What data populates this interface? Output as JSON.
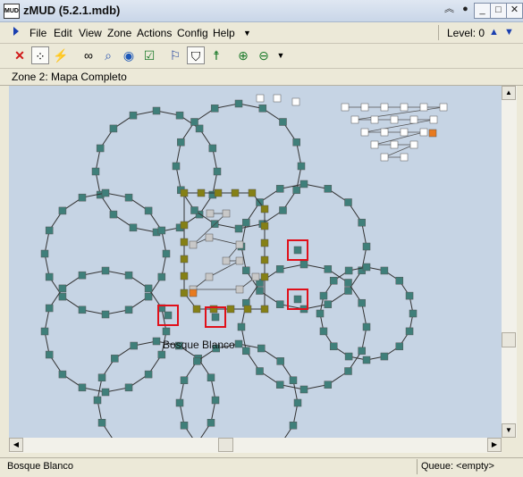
{
  "window": {
    "title": "zMUD (5.2.1.mdb)",
    "logo_text": "MUD"
  },
  "menu": [
    "File",
    "Edit",
    "View",
    "Zone",
    "Actions",
    "Config",
    "Help"
  ],
  "level": {
    "label": "Level: 0"
  },
  "toolbar_icons": [
    "close-red-x-icon",
    "dotted-grid-icon",
    "walk-path-icon",
    "binoculars-icon",
    "magnifier-icon",
    "globe-icon",
    "check-icon",
    "mapper-walk-icon",
    "mapper-select-icon",
    "person-walk-icon",
    "zoom-in-icon",
    "zoom-out-icon"
  ],
  "zone": {
    "title": "Zone 2: Mapa Completo"
  },
  "map": {
    "area_label": "Bosque Blanco"
  },
  "status": {
    "location": "Bosque Blanco",
    "queue": "Queue: <empty>"
  },
  "colors": {
    "teal_room": "#3f7f7a",
    "olive_room": "#858015",
    "grey_room": "#c8c8c8",
    "white_room": "#ffffff",
    "current_room": "#e87a1e",
    "highlight": "#e0101a",
    "map_bg": "#c6d4e4"
  }
}
